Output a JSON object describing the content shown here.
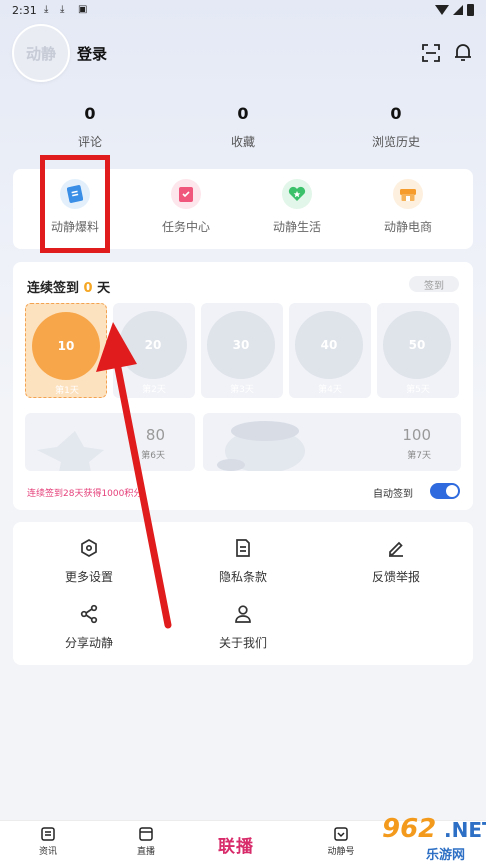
{
  "status_bar": {
    "time": "2:31"
  },
  "header": {
    "avatar_text": "动静",
    "login_label": "登录"
  },
  "stats": [
    {
      "count": "0",
      "label": "评论"
    },
    {
      "count": "0",
      "label": "收藏"
    },
    {
      "count": "0",
      "label": "浏览历史"
    }
  ],
  "features": [
    {
      "label": "动静爆料",
      "icon": "news-book-icon",
      "color": "#3a8ee6"
    },
    {
      "label": "任务中心",
      "icon": "task-icon",
      "color": "#f0567b"
    },
    {
      "label": "动静生活",
      "icon": "heart-star-icon",
      "color": "#3cc16b"
    },
    {
      "label": "动静电商",
      "icon": "shop-icon",
      "color": "#f59c2c"
    }
  ],
  "signin": {
    "title_prefix": "连续签到",
    "streak": "0",
    "title_suffix": "天",
    "button_label": "签到",
    "days": [
      {
        "points": "10",
        "label": "第1天"
      },
      {
        "points": "20",
        "label": "第2天"
      },
      {
        "points": "30",
        "label": "第3天"
      },
      {
        "points": "40",
        "label": "第4天"
      },
      {
        "points": "50",
        "label": "第5天"
      }
    ],
    "big_days": [
      {
        "points": "80",
        "label": "第6天"
      },
      {
        "points": "100",
        "label": "第7天"
      }
    ],
    "hint": "连续签到28天获得1000积分",
    "auto_label": "自动签到"
  },
  "settings": [
    {
      "label": "更多设置",
      "icon": "hexagon-settings-icon"
    },
    {
      "label": "隐私条款",
      "icon": "document-icon"
    },
    {
      "label": "反馈举报",
      "icon": "edit-pen-icon"
    },
    {
      "label": "分享动静",
      "icon": "share-icon"
    },
    {
      "label": "关于我们",
      "icon": "user-icon"
    }
  ],
  "bottom_nav": {
    "items": [
      {
        "label": "资讯"
      },
      {
        "label": "直播"
      },
      {
        "label": "动静号"
      }
    ],
    "live_label": "联播"
  },
  "watermark": {
    "number": "962",
    "domain": ".NET",
    "name": "乐游网"
  },
  "colors": {
    "accent": "#f5a623",
    "toggle": "#2f6bde",
    "annotation": "#e01c1c",
    "hint": "#e5407a"
  }
}
